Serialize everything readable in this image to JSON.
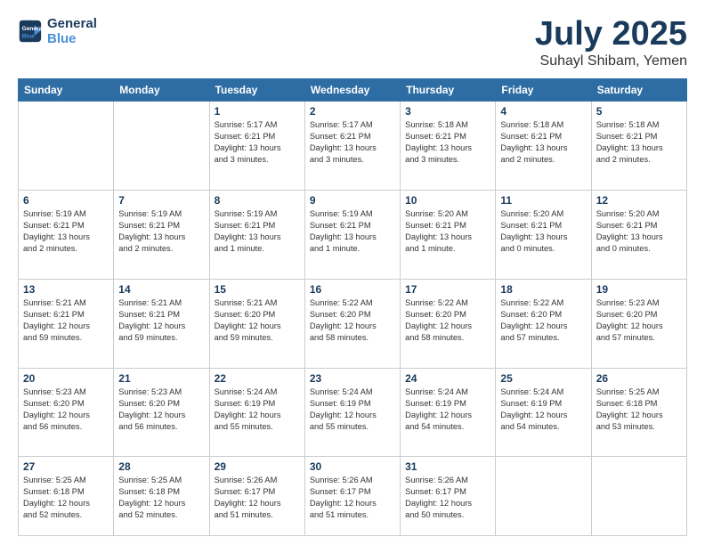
{
  "header": {
    "logo_line1": "General",
    "logo_line2": "Blue",
    "title": "July 2025",
    "subtitle": "Suhayl Shibam, Yemen"
  },
  "weekdays": [
    "Sunday",
    "Monday",
    "Tuesday",
    "Wednesday",
    "Thursday",
    "Friday",
    "Saturday"
  ],
  "weeks": [
    [
      {
        "day": "",
        "info": ""
      },
      {
        "day": "",
        "info": ""
      },
      {
        "day": "1",
        "info": "Sunrise: 5:17 AM\nSunset: 6:21 PM\nDaylight: 13 hours\nand 3 minutes."
      },
      {
        "day": "2",
        "info": "Sunrise: 5:17 AM\nSunset: 6:21 PM\nDaylight: 13 hours\nand 3 minutes."
      },
      {
        "day": "3",
        "info": "Sunrise: 5:18 AM\nSunset: 6:21 PM\nDaylight: 13 hours\nand 3 minutes."
      },
      {
        "day": "4",
        "info": "Sunrise: 5:18 AM\nSunset: 6:21 PM\nDaylight: 13 hours\nand 2 minutes."
      },
      {
        "day": "5",
        "info": "Sunrise: 5:18 AM\nSunset: 6:21 PM\nDaylight: 13 hours\nand 2 minutes."
      }
    ],
    [
      {
        "day": "6",
        "info": "Sunrise: 5:19 AM\nSunset: 6:21 PM\nDaylight: 13 hours\nand 2 minutes."
      },
      {
        "day": "7",
        "info": "Sunrise: 5:19 AM\nSunset: 6:21 PM\nDaylight: 13 hours\nand 2 minutes."
      },
      {
        "day": "8",
        "info": "Sunrise: 5:19 AM\nSunset: 6:21 PM\nDaylight: 13 hours\nand 1 minute."
      },
      {
        "day": "9",
        "info": "Sunrise: 5:19 AM\nSunset: 6:21 PM\nDaylight: 13 hours\nand 1 minute."
      },
      {
        "day": "10",
        "info": "Sunrise: 5:20 AM\nSunset: 6:21 PM\nDaylight: 13 hours\nand 1 minute."
      },
      {
        "day": "11",
        "info": "Sunrise: 5:20 AM\nSunset: 6:21 PM\nDaylight: 13 hours\nand 0 minutes."
      },
      {
        "day": "12",
        "info": "Sunrise: 5:20 AM\nSunset: 6:21 PM\nDaylight: 13 hours\nand 0 minutes."
      }
    ],
    [
      {
        "day": "13",
        "info": "Sunrise: 5:21 AM\nSunset: 6:21 PM\nDaylight: 12 hours\nand 59 minutes."
      },
      {
        "day": "14",
        "info": "Sunrise: 5:21 AM\nSunset: 6:21 PM\nDaylight: 12 hours\nand 59 minutes."
      },
      {
        "day": "15",
        "info": "Sunrise: 5:21 AM\nSunset: 6:20 PM\nDaylight: 12 hours\nand 59 minutes."
      },
      {
        "day": "16",
        "info": "Sunrise: 5:22 AM\nSunset: 6:20 PM\nDaylight: 12 hours\nand 58 minutes."
      },
      {
        "day": "17",
        "info": "Sunrise: 5:22 AM\nSunset: 6:20 PM\nDaylight: 12 hours\nand 58 minutes."
      },
      {
        "day": "18",
        "info": "Sunrise: 5:22 AM\nSunset: 6:20 PM\nDaylight: 12 hours\nand 57 minutes."
      },
      {
        "day": "19",
        "info": "Sunrise: 5:23 AM\nSunset: 6:20 PM\nDaylight: 12 hours\nand 57 minutes."
      }
    ],
    [
      {
        "day": "20",
        "info": "Sunrise: 5:23 AM\nSunset: 6:20 PM\nDaylight: 12 hours\nand 56 minutes."
      },
      {
        "day": "21",
        "info": "Sunrise: 5:23 AM\nSunset: 6:20 PM\nDaylight: 12 hours\nand 56 minutes."
      },
      {
        "day": "22",
        "info": "Sunrise: 5:24 AM\nSunset: 6:19 PM\nDaylight: 12 hours\nand 55 minutes."
      },
      {
        "day": "23",
        "info": "Sunrise: 5:24 AM\nSunset: 6:19 PM\nDaylight: 12 hours\nand 55 minutes."
      },
      {
        "day": "24",
        "info": "Sunrise: 5:24 AM\nSunset: 6:19 PM\nDaylight: 12 hours\nand 54 minutes."
      },
      {
        "day": "25",
        "info": "Sunrise: 5:24 AM\nSunset: 6:19 PM\nDaylight: 12 hours\nand 54 minutes."
      },
      {
        "day": "26",
        "info": "Sunrise: 5:25 AM\nSunset: 6:18 PM\nDaylight: 12 hours\nand 53 minutes."
      }
    ],
    [
      {
        "day": "27",
        "info": "Sunrise: 5:25 AM\nSunset: 6:18 PM\nDaylight: 12 hours\nand 52 minutes."
      },
      {
        "day": "28",
        "info": "Sunrise: 5:25 AM\nSunset: 6:18 PM\nDaylight: 12 hours\nand 52 minutes."
      },
      {
        "day": "29",
        "info": "Sunrise: 5:26 AM\nSunset: 6:17 PM\nDaylight: 12 hours\nand 51 minutes."
      },
      {
        "day": "30",
        "info": "Sunrise: 5:26 AM\nSunset: 6:17 PM\nDaylight: 12 hours\nand 51 minutes."
      },
      {
        "day": "31",
        "info": "Sunrise: 5:26 AM\nSunset: 6:17 PM\nDaylight: 12 hours\nand 50 minutes."
      },
      {
        "day": "",
        "info": ""
      },
      {
        "day": "",
        "info": ""
      }
    ]
  ]
}
